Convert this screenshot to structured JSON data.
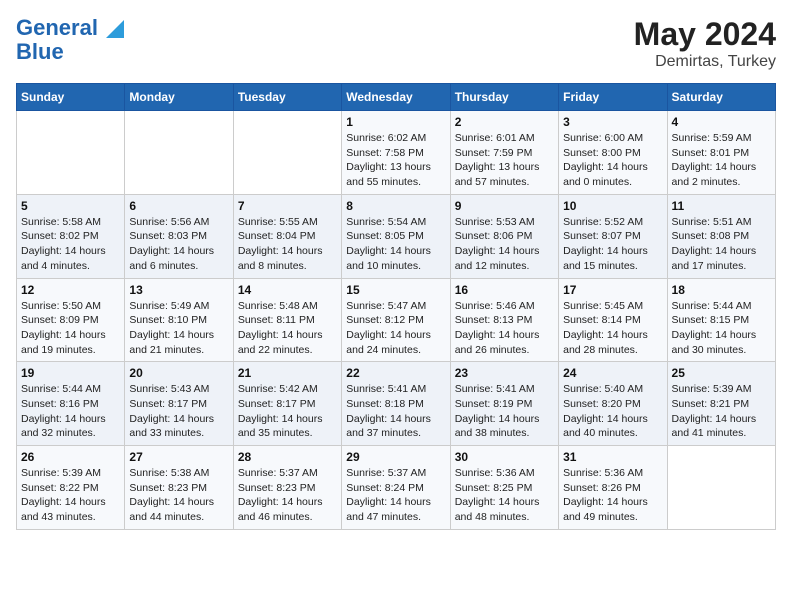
{
  "header": {
    "logo_line1": "General",
    "logo_line2": "Blue",
    "title": "May 2024",
    "subtitle": "Demirtas, Turkey"
  },
  "weekdays": [
    "Sunday",
    "Monday",
    "Tuesday",
    "Wednesday",
    "Thursday",
    "Friday",
    "Saturday"
  ],
  "weeks": [
    [
      {
        "day": "",
        "info": ""
      },
      {
        "day": "",
        "info": ""
      },
      {
        "day": "",
        "info": ""
      },
      {
        "day": "1",
        "info": "Sunrise: 6:02 AM\nSunset: 7:58 PM\nDaylight: 13 hours and 55 minutes."
      },
      {
        "day": "2",
        "info": "Sunrise: 6:01 AM\nSunset: 7:59 PM\nDaylight: 13 hours and 57 minutes."
      },
      {
        "day": "3",
        "info": "Sunrise: 6:00 AM\nSunset: 8:00 PM\nDaylight: 14 hours and 0 minutes."
      },
      {
        "day": "4",
        "info": "Sunrise: 5:59 AM\nSunset: 8:01 PM\nDaylight: 14 hours and 2 minutes."
      }
    ],
    [
      {
        "day": "5",
        "info": "Sunrise: 5:58 AM\nSunset: 8:02 PM\nDaylight: 14 hours and 4 minutes."
      },
      {
        "day": "6",
        "info": "Sunrise: 5:56 AM\nSunset: 8:03 PM\nDaylight: 14 hours and 6 minutes."
      },
      {
        "day": "7",
        "info": "Sunrise: 5:55 AM\nSunset: 8:04 PM\nDaylight: 14 hours and 8 minutes."
      },
      {
        "day": "8",
        "info": "Sunrise: 5:54 AM\nSunset: 8:05 PM\nDaylight: 14 hours and 10 minutes."
      },
      {
        "day": "9",
        "info": "Sunrise: 5:53 AM\nSunset: 8:06 PM\nDaylight: 14 hours and 12 minutes."
      },
      {
        "day": "10",
        "info": "Sunrise: 5:52 AM\nSunset: 8:07 PM\nDaylight: 14 hours and 15 minutes."
      },
      {
        "day": "11",
        "info": "Sunrise: 5:51 AM\nSunset: 8:08 PM\nDaylight: 14 hours and 17 minutes."
      }
    ],
    [
      {
        "day": "12",
        "info": "Sunrise: 5:50 AM\nSunset: 8:09 PM\nDaylight: 14 hours and 19 minutes."
      },
      {
        "day": "13",
        "info": "Sunrise: 5:49 AM\nSunset: 8:10 PM\nDaylight: 14 hours and 21 minutes."
      },
      {
        "day": "14",
        "info": "Sunrise: 5:48 AM\nSunset: 8:11 PM\nDaylight: 14 hours and 22 minutes."
      },
      {
        "day": "15",
        "info": "Sunrise: 5:47 AM\nSunset: 8:12 PM\nDaylight: 14 hours and 24 minutes."
      },
      {
        "day": "16",
        "info": "Sunrise: 5:46 AM\nSunset: 8:13 PM\nDaylight: 14 hours and 26 minutes."
      },
      {
        "day": "17",
        "info": "Sunrise: 5:45 AM\nSunset: 8:14 PM\nDaylight: 14 hours and 28 minutes."
      },
      {
        "day": "18",
        "info": "Sunrise: 5:44 AM\nSunset: 8:15 PM\nDaylight: 14 hours and 30 minutes."
      }
    ],
    [
      {
        "day": "19",
        "info": "Sunrise: 5:44 AM\nSunset: 8:16 PM\nDaylight: 14 hours and 32 minutes."
      },
      {
        "day": "20",
        "info": "Sunrise: 5:43 AM\nSunset: 8:17 PM\nDaylight: 14 hours and 33 minutes."
      },
      {
        "day": "21",
        "info": "Sunrise: 5:42 AM\nSunset: 8:17 PM\nDaylight: 14 hours and 35 minutes."
      },
      {
        "day": "22",
        "info": "Sunrise: 5:41 AM\nSunset: 8:18 PM\nDaylight: 14 hours and 37 minutes."
      },
      {
        "day": "23",
        "info": "Sunrise: 5:41 AM\nSunset: 8:19 PM\nDaylight: 14 hours and 38 minutes."
      },
      {
        "day": "24",
        "info": "Sunrise: 5:40 AM\nSunset: 8:20 PM\nDaylight: 14 hours and 40 minutes."
      },
      {
        "day": "25",
        "info": "Sunrise: 5:39 AM\nSunset: 8:21 PM\nDaylight: 14 hours and 41 minutes."
      }
    ],
    [
      {
        "day": "26",
        "info": "Sunrise: 5:39 AM\nSunset: 8:22 PM\nDaylight: 14 hours and 43 minutes."
      },
      {
        "day": "27",
        "info": "Sunrise: 5:38 AM\nSunset: 8:23 PM\nDaylight: 14 hours and 44 minutes."
      },
      {
        "day": "28",
        "info": "Sunrise: 5:37 AM\nSunset: 8:23 PM\nDaylight: 14 hours and 46 minutes."
      },
      {
        "day": "29",
        "info": "Sunrise: 5:37 AM\nSunset: 8:24 PM\nDaylight: 14 hours and 47 minutes."
      },
      {
        "day": "30",
        "info": "Sunrise: 5:36 AM\nSunset: 8:25 PM\nDaylight: 14 hours and 48 minutes."
      },
      {
        "day": "31",
        "info": "Sunrise: 5:36 AM\nSunset: 8:26 PM\nDaylight: 14 hours and 49 minutes."
      },
      {
        "day": "",
        "info": ""
      }
    ]
  ]
}
